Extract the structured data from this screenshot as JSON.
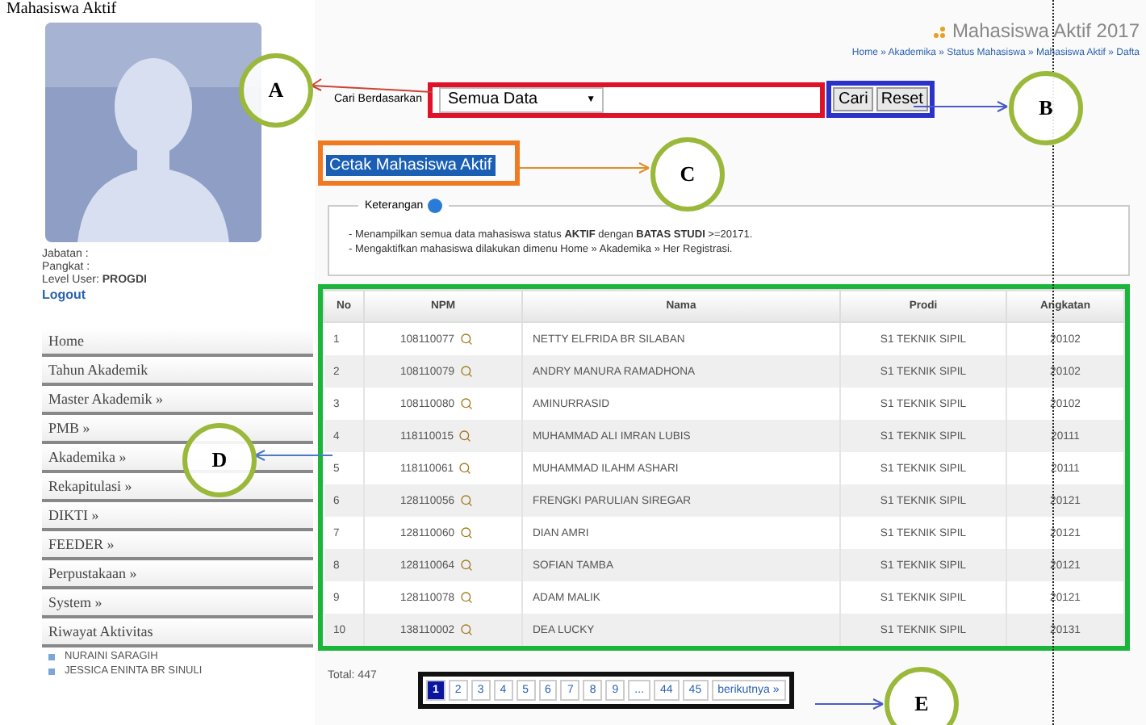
{
  "page_title": "Mahasiswa Aktif",
  "profile": {
    "fields": [
      {
        "label": "Jabatan",
        "value": ":"
      },
      {
        "label": "Pangkat",
        "value": ":"
      },
      {
        "label": "Level User:",
        "value": "PROGDI"
      }
    ],
    "logout": "Logout"
  },
  "sidebar": {
    "items": [
      "Home",
      "Tahun Akademik",
      "Master Akademik »",
      "PMB »",
      "Akademika »",
      "Rekapitulasi »",
      "DIKTI »",
      "FEEDER »",
      "Perpustakaan »",
      "System »",
      "Riwayat Aktivitas"
    ],
    "activity": [
      "NURAINI SARAGIH",
      "JESSICA ENINTA BR SINULI"
    ]
  },
  "header": {
    "title": "Mahasiswa Aktif 2017",
    "breadcrumb": "Home » Akademika » Status Mahasiswa » Mahasiswa Aktif » Dafta"
  },
  "search": {
    "label": "Cari Berdasarkan",
    "value": "Semua Data",
    "caret": "▼",
    "buttons": [
      "Cari",
      "Reset"
    ]
  },
  "print_button": "Cetak Mahasiswa Aktif",
  "info": {
    "legend": "Keterangan",
    "lines": [
      "- Menampilkan semua data mahasiswa status **AKTIF** dengan **BATAS STUDI** >=20171.",
      "- Mengaktifkan mahasiswa dilakukan dimenu Home » Akademika » Her Registrasi."
    ]
  },
  "table": {
    "columns": [
      "No",
      "NPM",
      "Nama",
      "Prodi",
      "Angkatan"
    ],
    "rows": [
      [
        "1",
        "108110077",
        "NETTY ELFRIDA BR SILABAN",
        "S1 TEKNIK SIPIL",
        "20102"
      ],
      [
        "2",
        "108110079",
        "ANDRY MANURA RAMADHONA",
        "S1 TEKNIK SIPIL",
        "20102"
      ],
      [
        "3",
        "108110080",
        "AMINURRASID",
        "S1 TEKNIK SIPIL",
        "20102"
      ],
      [
        "4",
        "118110015",
        "MUHAMMAD ALI IMRAN LUBIS",
        "S1 TEKNIK SIPIL",
        "20111"
      ],
      [
        "5",
        "118110061",
        "MUHAMMAD ILAHM ASHARI",
        "S1 TEKNIK SIPIL",
        "20111"
      ],
      [
        "6",
        "128110056",
        "FRENGKI PARULIAN SIREGAR",
        "S1 TEKNIK SIPIL",
        "20121"
      ],
      [
        "7",
        "128110060",
        "DIAN AMRI",
        "S1 TEKNIK SIPIL",
        "20121"
      ],
      [
        "8",
        "128110064",
        "SOFIAN TAMBA",
        "S1 TEKNIK SIPIL",
        "20121"
      ],
      [
        "9",
        "128110078",
        "ADAM MALIK",
        "S1 TEKNIK SIPIL",
        "20121"
      ],
      [
        "10",
        "138110002",
        "DEA LUCKY",
        "S1 TEKNIK SIPIL",
        "20131"
      ]
    ]
  },
  "total": "Total: 447",
  "pagination": [
    {
      "label": "1",
      "selected": true
    },
    {
      "label": "2",
      "selected": false
    },
    {
      "label": "3",
      "selected": false
    },
    {
      "label": "4",
      "selected": false
    },
    {
      "label": "5",
      "selected": false
    },
    {
      "label": "6",
      "selected": false
    },
    {
      "label": "7",
      "selected": false
    },
    {
      "label": "8",
      "selected": false
    },
    {
      "label": "9",
      "selected": false
    },
    {
      "label": "...",
      "selected": false
    },
    {
      "label": "44",
      "selected": false
    },
    {
      "label": "45",
      "selected": false
    },
    {
      "label": "berikutnya »",
      "selected": false
    }
  ],
  "annotations": [
    "A",
    "B",
    "C",
    "D",
    "E"
  ]
}
